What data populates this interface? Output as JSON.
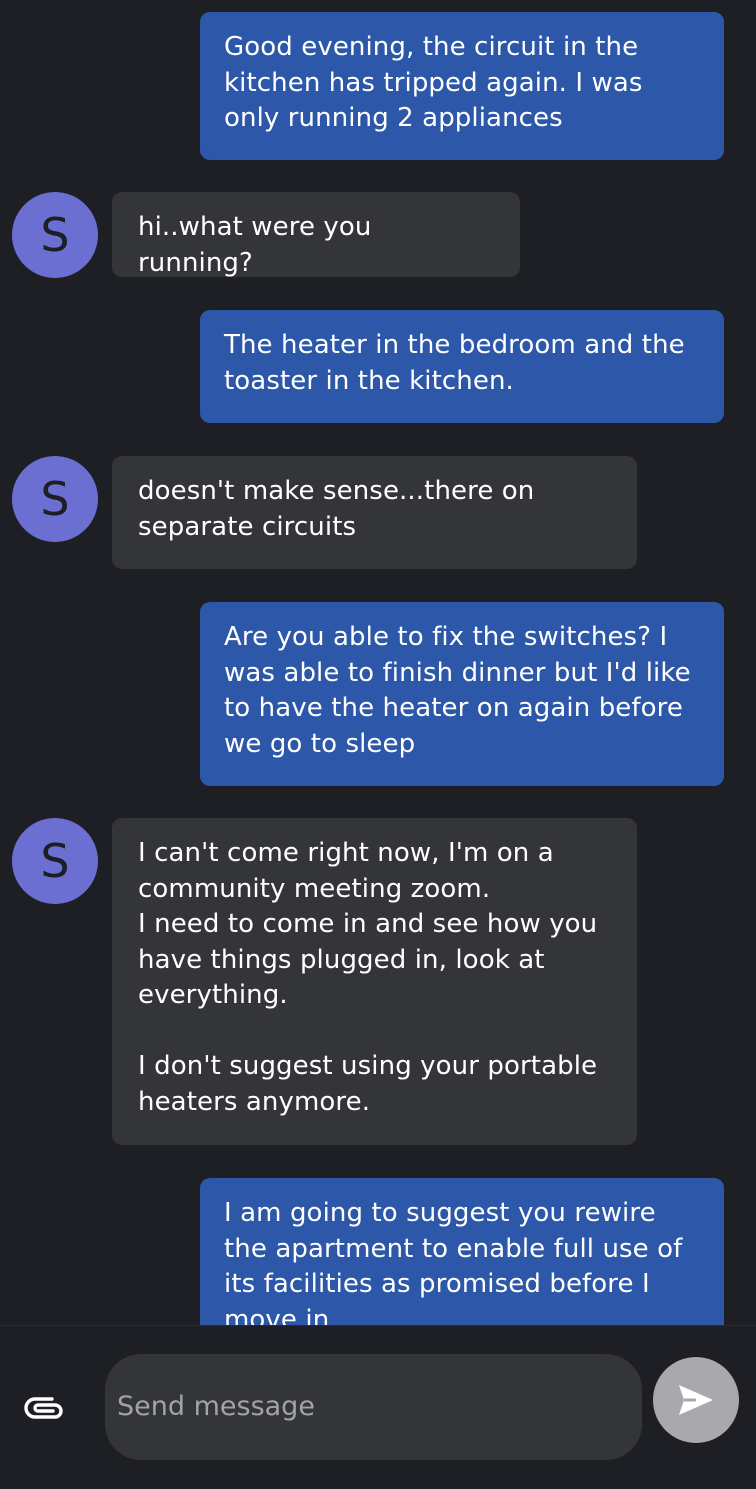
{
  "messages": [
    {
      "direction": "sent",
      "text": "Good evening, the circuit in the\nkitchen has tripped again. I was\nonly running 2 appliances"
    },
    {
      "direction": "received",
      "avatar": "S",
      "text": "hi..what were you running?"
    },
    {
      "direction": "sent",
      "text": "The heater in the bedroom and the\ntoaster in the kitchen."
    },
    {
      "direction": "received",
      "avatar": "S",
      "text": "doesn't make sense...there on\nseparate circuits"
    },
    {
      "direction": "sent",
      "text": "Are you able to fix the switches? I\nwas able to finish dinner but I'd like\nto have the heater on again before\nwe go to sleep"
    },
    {
      "direction": "received",
      "avatar": "S",
      "text": "I can't come right now, I'm on a\ncommunity meeting zoom.\nI need to come in and see how you\nhave things plugged in, look at\neverything.\n\nI don't suggest using your portable\nheaters anymore."
    },
    {
      "direction": "sent",
      "text": "I am going to suggest you rewire\nthe apartment to enable full use of\nits facilities as promised before I\nmove in"
    }
  ],
  "composer": {
    "placeholder": "Send message",
    "attach_icon": "paperclip-icon",
    "send_icon": "send-icon"
  },
  "colors": {
    "background": "#1e1f24",
    "sent_bubble": "#2d57a8",
    "received_bubble": "#343539",
    "avatar": "#6b6fd2",
    "send_button": "#a9a9ad"
  }
}
